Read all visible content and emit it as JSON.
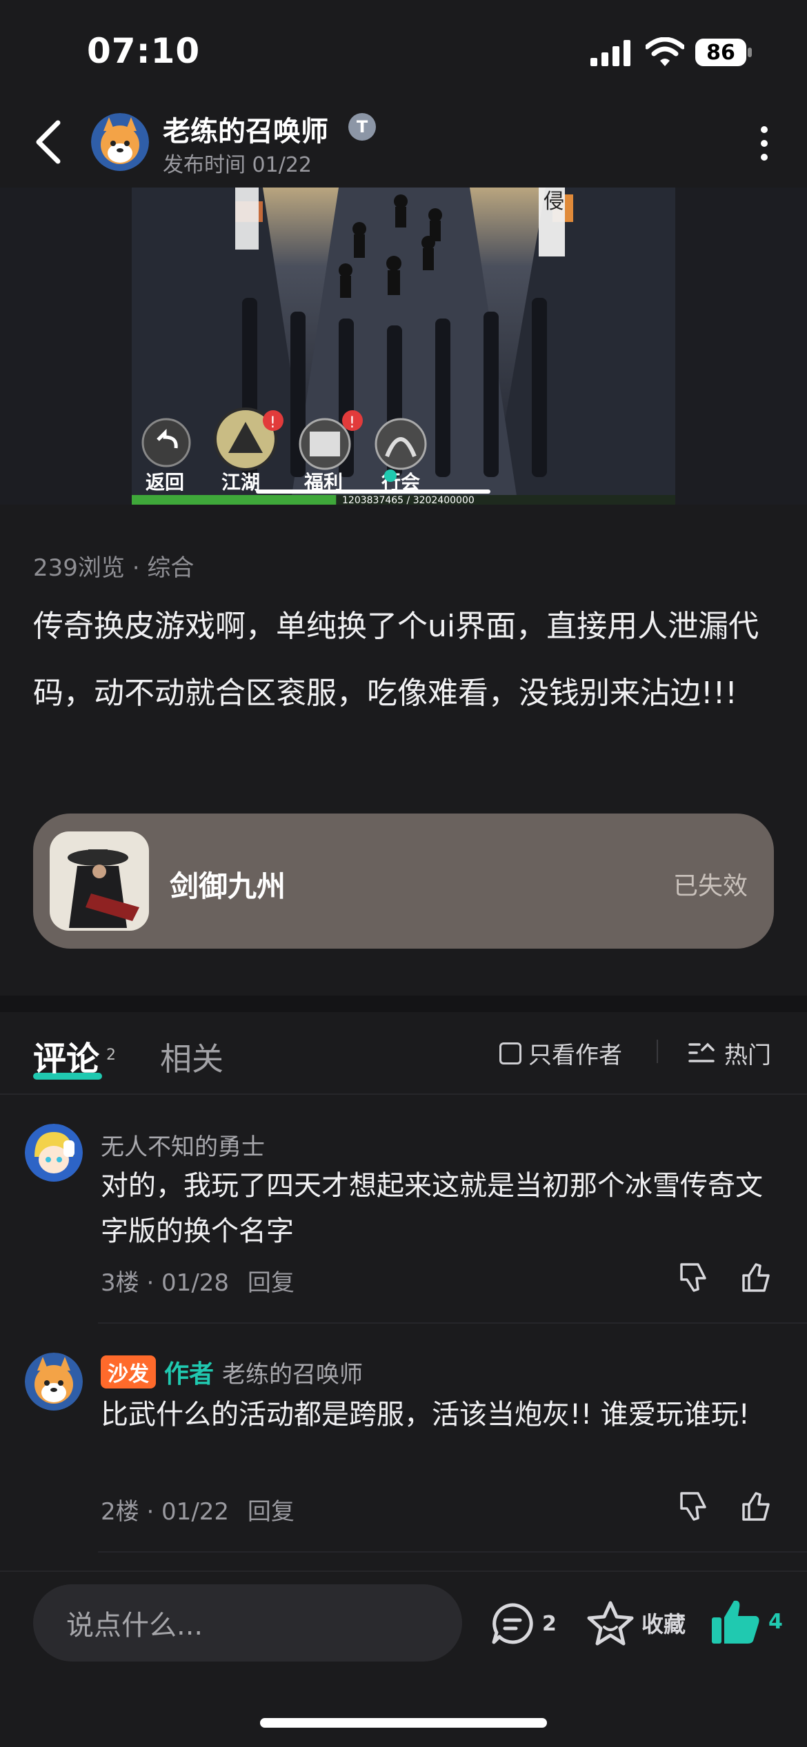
{
  "status_bar": {
    "time": "07:10",
    "battery": "86"
  },
  "header": {
    "author_name": "老练的召唤师",
    "author_badge": "T",
    "post_time": "发布时间 01/22"
  },
  "hero": {
    "buttons": [
      "返回",
      "江湖",
      "福利",
      "行会"
    ],
    "top_sign": "侵",
    "progress_text": "1203837465 / 3202400000",
    "progress_fraction": 0.376
  },
  "post": {
    "meta": "239浏览 · 综合",
    "content": "传奇换皮游戏啊，单纯换了个ui界面，直接用人泄漏代码，动不动就合区衮服，吃像难看，没钱别来沾边!!!"
  },
  "game_card": {
    "name": "剑御九州",
    "status": "已失效"
  },
  "tabs": {
    "comments_label": "评论",
    "comments_count": "2",
    "related_label": "相关",
    "only_author_label": "只看作者",
    "sort_label": "热门"
  },
  "comments": [
    {
      "name": "无人不知的勇士",
      "text": "对的，我玩了四天才想起来这就是当初那个冰雪传奇文字版的换个名字",
      "floor": "3楼 · 01/28",
      "reply": "回复"
    },
    {
      "tag": "沙发",
      "author_tag": "作者",
      "name": "老练的召唤师",
      "text": "比武什么的活动都是跨服，活该当炮灰!! 谁爱玩谁玩!",
      "floor": "2楼 · 01/22",
      "reply": "回复"
    }
  ],
  "bottom_bar": {
    "input_placeholder": "说点什么...",
    "comment_count": "2",
    "favorite_label": "收藏",
    "like_count": "4"
  },
  "colors": {
    "accent": "#20c9b0",
    "sofa": "#ff6a2b",
    "card": "#6a625e"
  }
}
